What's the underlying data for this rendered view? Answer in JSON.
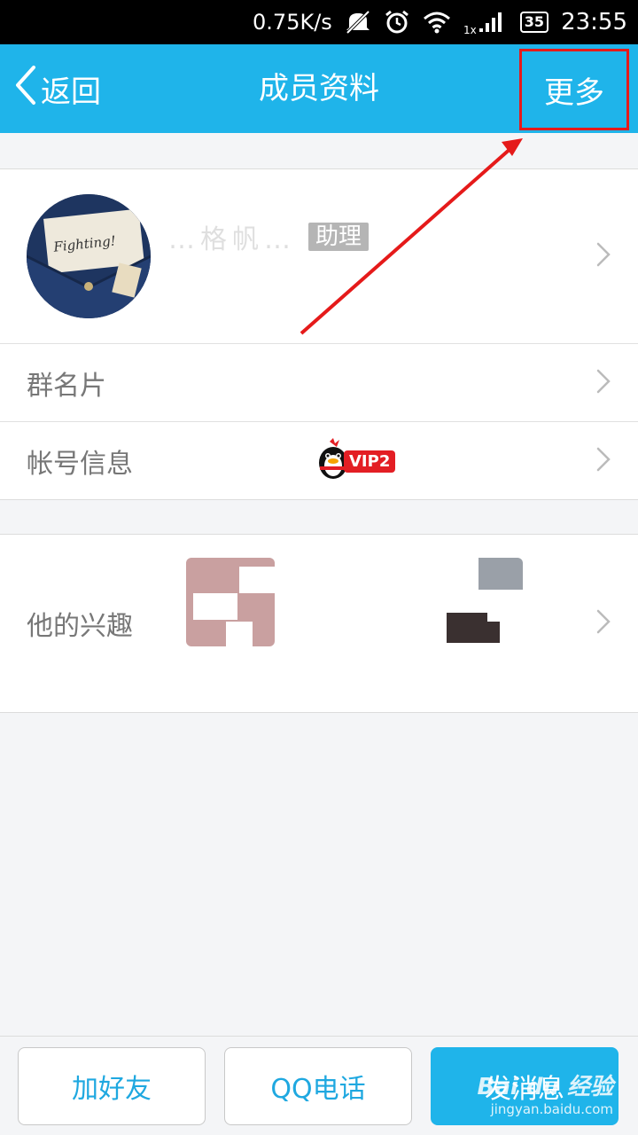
{
  "status_bar": {
    "net_speed": "0.75K/s",
    "icons": [
      "mute-icon",
      "alarm-icon",
      "wifi-icon",
      "signal-icon"
    ],
    "battery": "35",
    "time": "23:55"
  },
  "header": {
    "back_label": "返回",
    "title": "成员资料",
    "more_label": "更多",
    "bg_color": "#1fb4ea"
  },
  "profile": {
    "name": "…格帆…",
    "role_badge": "助理",
    "avatar_text": "Fighting!"
  },
  "rows": {
    "group_card_label": "群名片",
    "account_info_label": "帐号信息",
    "vip_badge": "VIP2",
    "interests_label": "他的兴趣"
  },
  "bottom_bar": {
    "add_friend_label": "加好友",
    "call_label": "QQ电话",
    "send_message_label": "发消息",
    "accent_color": "#1fa8e0"
  },
  "watermark": {
    "logo": "Bai du 经验",
    "url": "jingyan.baidu.com"
  },
  "annotation": {
    "highlight_color": "#e51a1a"
  }
}
